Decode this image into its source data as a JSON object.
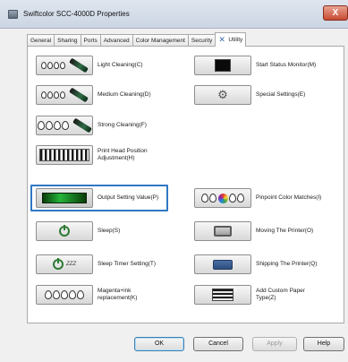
{
  "window": {
    "title": "Swiftcolor SCC-4000D Properties",
    "close_glyph": "X"
  },
  "tabs": [
    {
      "label": "General",
      "active": false
    },
    {
      "label": "Sharing",
      "active": false
    },
    {
      "label": "Ports",
      "active": false
    },
    {
      "label": "Advanced",
      "active": false
    },
    {
      "label": "Color Management",
      "active": false
    },
    {
      "label": "Security",
      "active": false
    },
    {
      "label": "Utility",
      "active": true,
      "icon": "wrench-icon"
    }
  ],
  "utility": {
    "left": [
      {
        "label": "Light Cleaning(C)",
        "icon": "light-cleaning-icon"
      },
      {
        "label": "Medium Cleaning(D)",
        "icon": "medium-cleaning-icon"
      },
      {
        "label": "Strong Cleaning(F)",
        "icon": "strong-cleaning-icon"
      },
      {
        "label_line1": "Print Head Position",
        "label_line2": "Adjustment(H)",
        "icon": "head-alignment-icon"
      },
      {
        "label": "Output Setting Value(P)",
        "icon": "output-setting-icon",
        "selected": true
      },
      {
        "label": "Sleep(S)",
        "icon": "power-icon"
      },
      {
        "label": "Sleep Timer Setting(T)",
        "icon": "sleep-timer-icon",
        "tile_text": "ZZZ"
      },
      {
        "label_line1": "Magenta+ink",
        "label_line2": "replacement(K)",
        "icon": "ink-replacement-icon"
      }
    ],
    "right": [
      {
        "label": "Start Status Monitor(M)",
        "icon": "status-monitor-icon"
      },
      {
        "label": "Special Settings(E)",
        "icon": "special-settings-icon"
      },
      {
        "label": "Pinpoint Color Matches(I)",
        "icon": "color-match-icon"
      },
      {
        "label": "Moving The Printer(O)",
        "icon": "moving-printer-icon"
      },
      {
        "label": "Shipping The Printer(Q)",
        "icon": "shipping-printer-icon"
      },
      {
        "label_line1": "Add Custom Paper",
        "label_line2": "Type(Z)",
        "icon": "custom-paper-icon"
      }
    ]
  },
  "buttons": {
    "ok": "OK",
    "cancel": "Cancel",
    "apply": "Apply",
    "help": "Help"
  },
  "colors": {
    "selection_outline": "#2f78c4",
    "ink_green": "#2f6d46"
  }
}
